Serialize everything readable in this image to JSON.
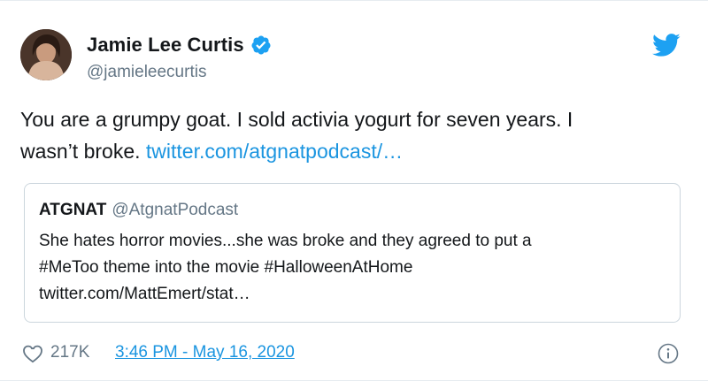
{
  "author": {
    "display_name": "Jamie Lee Curtis",
    "handle": "@jamieleecurtis",
    "verified": true
  },
  "tweet": {
    "text_line1": "You are a grumpy goat. I sold activia yogurt for seven years. I",
    "text_line2_prefix": "wasn’t broke.",
    "link_text": "twitter.com/atgnatpodcast/…"
  },
  "quoted_tweet": {
    "name": "ATGNAT",
    "handle": "@AtgnatPodcast",
    "line1": "She hates horror movies...she was broke and they agreed to put a",
    "line2": "#MeToo theme into the movie #HalloweenAtHome",
    "line3": "twitter.com/MattEmert/stat…"
  },
  "footer": {
    "likes": "217K",
    "timestamp": "3:46 PM - May 16, 2020"
  },
  "icons": {
    "verified": "verified-badge-icon",
    "brand": "twitter-bird-icon",
    "like": "heart-icon",
    "info": "info-icon"
  },
  "colors": {
    "link": "#1b95e0",
    "text": "#14171a",
    "secondary_text": "#657786",
    "border": "#ccd6dd",
    "brand": "#1da1f2"
  }
}
